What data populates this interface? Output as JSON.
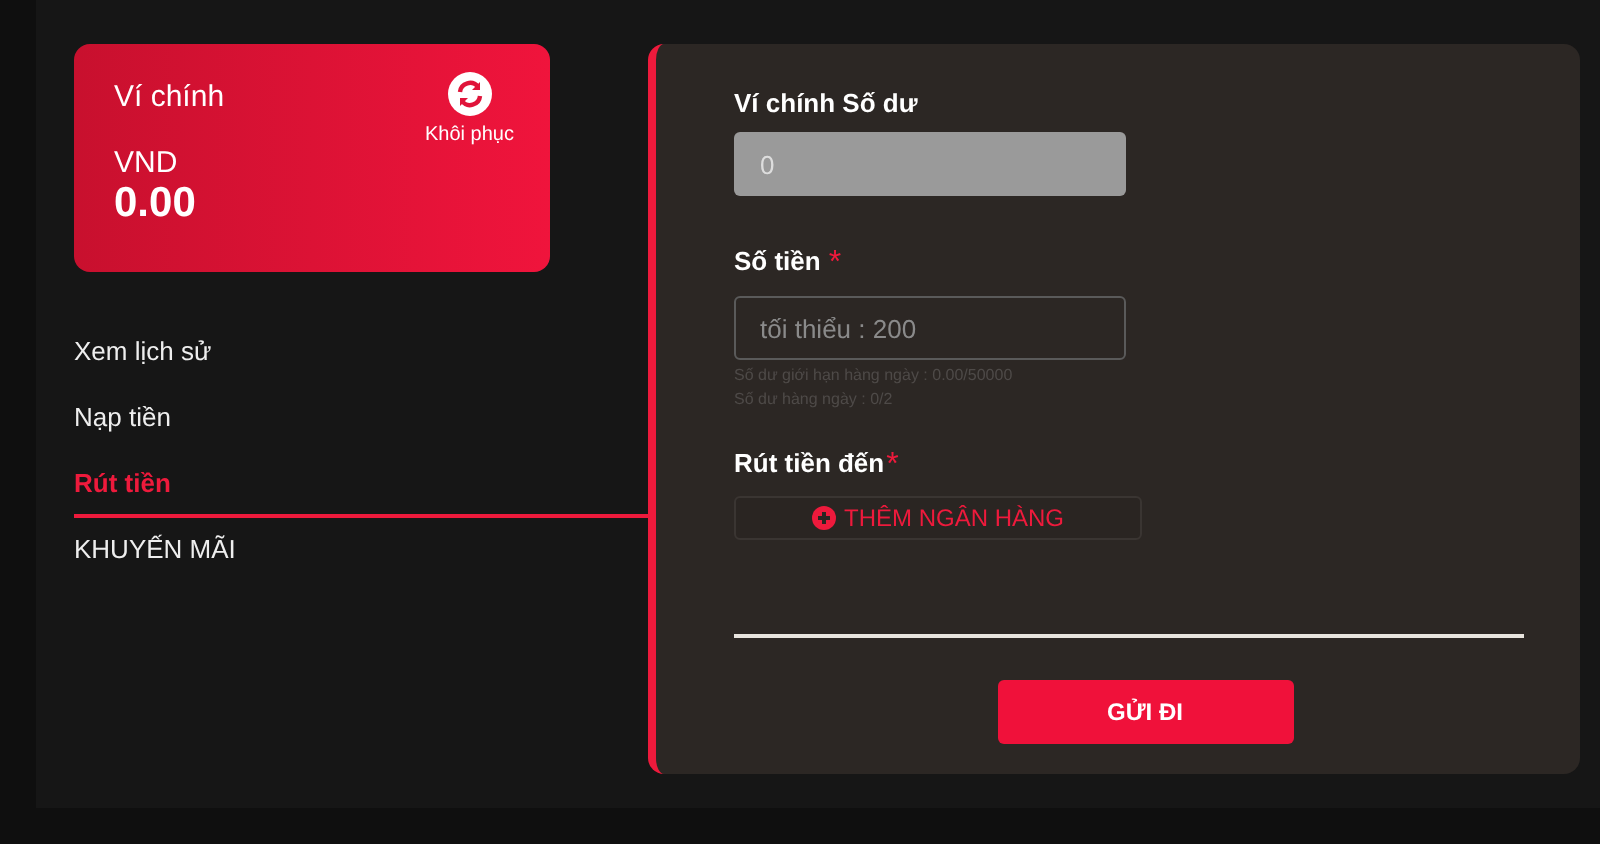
{
  "wallet": {
    "title": "Ví chính",
    "currency": "VND",
    "balance": "0.00",
    "restore_label": "Khôi phục"
  },
  "menu": [
    {
      "label": "Xem lịch sử",
      "selected": false
    },
    {
      "label": "Nạp tiền",
      "selected": false
    },
    {
      "label": "Rút tiền",
      "selected": true
    },
    {
      "label": "KHUYẾN MÃI",
      "selected": false
    }
  ],
  "form": {
    "balance_label": "Ví chính Số dư",
    "balance_value": "0",
    "amount_label": "Số tiền",
    "amount_required": "*",
    "amount_placeholder": "tối thiểu : 200",
    "hints": [
      "Số dư giới hạn hàng ngày : 0.00/50000",
      "Số dư hàng ngày : 0/2"
    ],
    "withdraw_to_label": "Rút tiền đến",
    "withdraw_to_required": "*",
    "add_bank_button": "THÊM NGÂN HÀNG",
    "submit_button": "GỬI ĐI"
  }
}
